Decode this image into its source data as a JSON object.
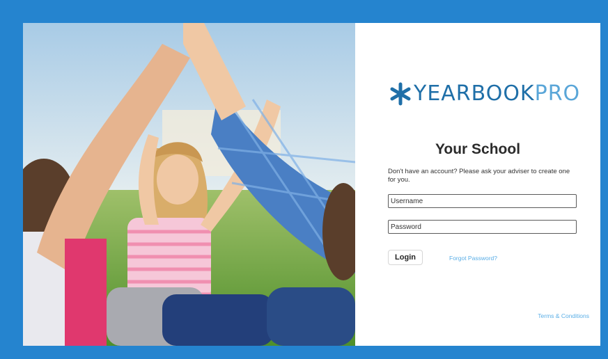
{
  "logo": {
    "mark": "asterisk-logo-icon",
    "text_main": "YEARBOOK",
    "text_accent": "PRO"
  },
  "login": {
    "title": "Your School",
    "hint": "Don't have an account? Please ask your adviser to create one for you.",
    "username_placeholder": "Username",
    "password_placeholder": "Password",
    "login_label": "Login",
    "forgot_label": "Forgot Password?",
    "terms_label": "Terms & Conditions"
  },
  "colors": {
    "frame_background": "#2584cf",
    "logo_dark": "#1f6fa8",
    "logo_light": "#5aa6d8",
    "link": "#5aaee6"
  }
}
